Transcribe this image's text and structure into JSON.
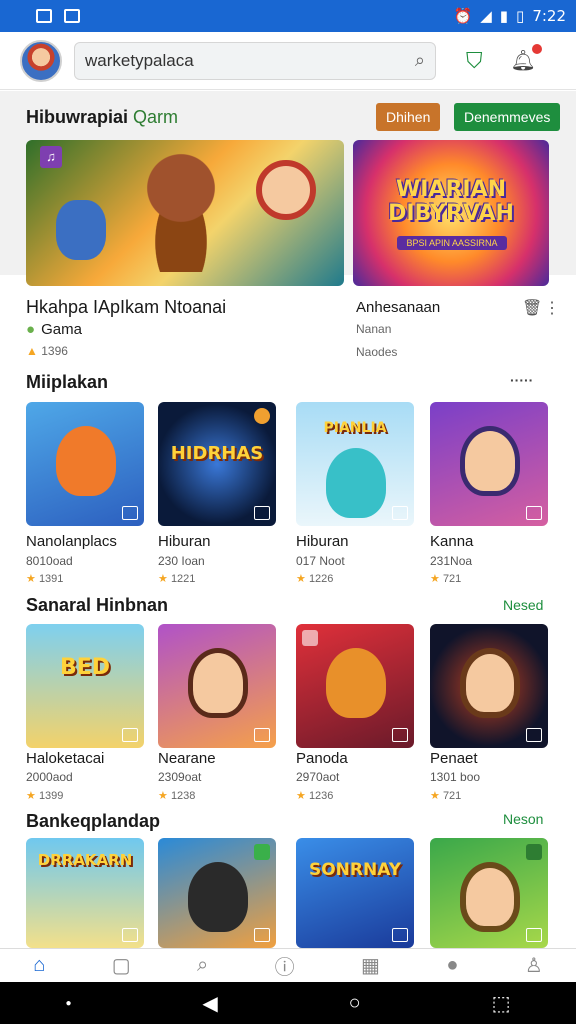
{
  "status": {
    "time": "7:22"
  },
  "search": {
    "placeholder": "warketypalaca"
  },
  "section1": {
    "title": "Hibuwrapiai",
    "accent": "Qarm",
    "chip_a": "Dhihen",
    "chip_b": "Denemmeves"
  },
  "banner2": {
    "title": "WIARIAN DIBYRVAH",
    "subtitle": "BPSI APIN AASSIRNA"
  },
  "featured": [
    {
      "name": "Hkahpa IApIkam Ntoanai",
      "category": "Gama",
      "meta": "1396"
    },
    {
      "name": "Anhesanaan",
      "category": "Nanan",
      "meta": "Naodes"
    }
  ],
  "sections": [
    {
      "title": "Miiplakan",
      "link": "·····"
    },
    {
      "title": "Sanaral Hinbnan",
      "link": "Nesed"
    },
    {
      "title": "Bankeqplandap",
      "link": "Neson"
    }
  ],
  "row1": [
    {
      "name": "Nanolanplacs",
      "count": "8010oad",
      "rating": "1391",
      "word": ""
    },
    {
      "name": "Hiburan",
      "count": "230 Ioan",
      "rating": "1221",
      "word": "HIDRHAS"
    },
    {
      "name": "Hiburan",
      "count": "017 Noot",
      "rating": "1226",
      "word": "PIANLIA"
    },
    {
      "name": "Kanna",
      "count": "231Noa",
      "rating": "721",
      "word": ""
    }
  ],
  "row2": [
    {
      "name": "Haloketacai",
      "count": "2000aod",
      "rating": "1399",
      "word": "BED"
    },
    {
      "name": "Nearane",
      "count": "2309oat",
      "rating": "1238",
      "word": ""
    },
    {
      "name": "Panoda",
      "count": "2970aot",
      "rating": "1236",
      "word": ""
    },
    {
      "name": "Penaet",
      "count": "1301 boo",
      "rating": "721",
      "word": ""
    }
  ],
  "row3": [
    {
      "word": "DRRAKARN"
    },
    {
      "word": ""
    },
    {
      "word": "SONRNAY"
    },
    {
      "word": ""
    }
  ],
  "colors": {
    "brand": "#1967d2",
    "accent_green": "#1e8e3e",
    "chip_orange": "#c8742a",
    "star": "#f5a623"
  }
}
